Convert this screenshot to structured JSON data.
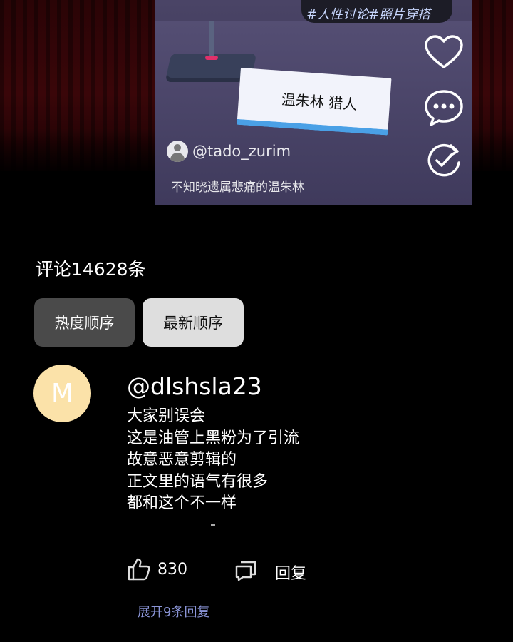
{
  "video": {
    "hashtags": "#人性讨论#照片穿搭",
    "nameplate": "温朱林 猎人",
    "uploader": "@tado_zurim",
    "caption": "不知晓遗属悲痛的温朱林"
  },
  "actions": {
    "like_icon": "heart-outline-icon",
    "comment_icon": "chat-bubble-icon",
    "repost_icon": "refresh-check-icon"
  },
  "comments": {
    "count_label": "评论14628条",
    "sort": {
      "hot_label": "热度顺序",
      "new_label": "最新顺序"
    },
    "items": [
      {
        "avatar_letter": "M",
        "avatar_color": "#fbe2a9",
        "username": "@dlshsla23",
        "lines": [
          "大家别误会",
          "这是油管上黑粉为了引流",
          "故意恶意剪辑的",
          "正文里的语气有很多",
          "都和这个不一样"
        ],
        "like_count": "830",
        "reply_label": "回复",
        "expand_label": "展开9条回复"
      }
    ]
  },
  "colors": {
    "background": "#000000",
    "link": "#8a94d6",
    "sort_active": "#4a4a4a",
    "sort_inactive": "#dedede"
  }
}
